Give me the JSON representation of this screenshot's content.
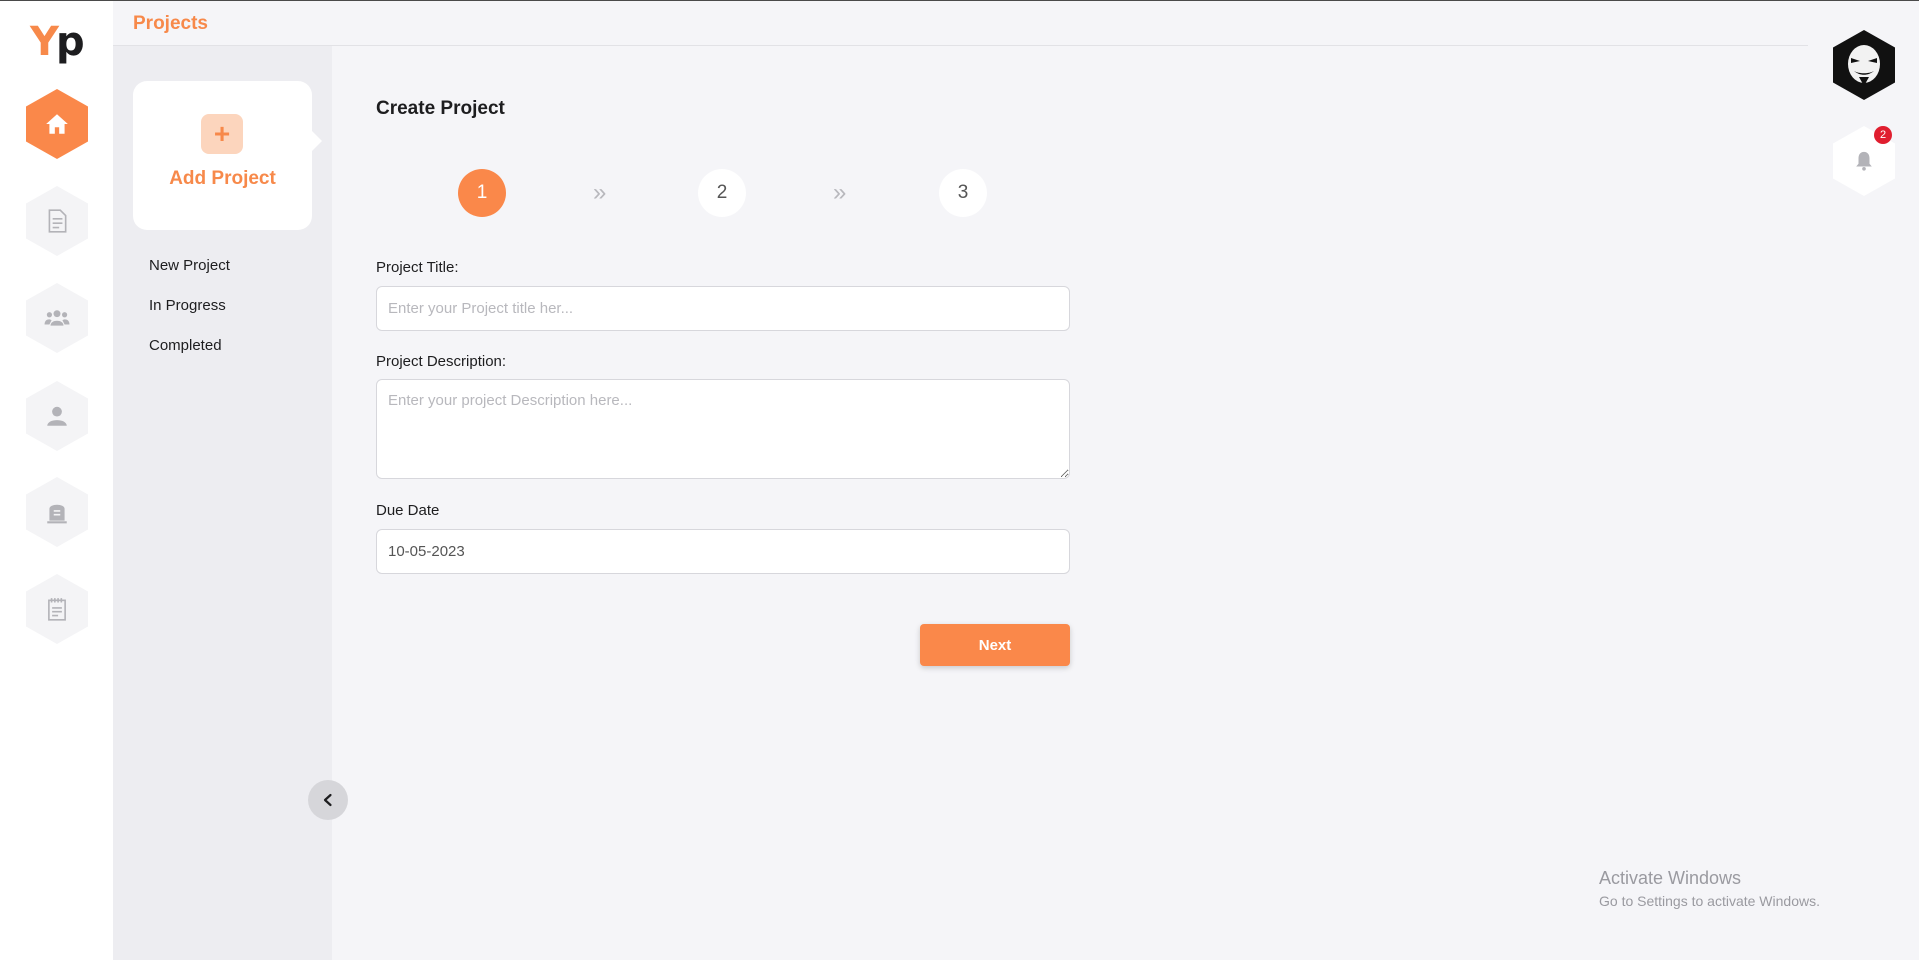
{
  "app": {
    "logo_y": "Y",
    "logo_p": "p",
    "brand_color": "#fa884a"
  },
  "header": {
    "title": "Projects"
  },
  "rail": {
    "items": [
      {
        "icon": "home-icon",
        "active": true
      },
      {
        "icon": "document-icon",
        "active": false
      },
      {
        "icon": "team-icon",
        "active": false
      },
      {
        "icon": "user-icon",
        "active": false
      },
      {
        "icon": "tombstone-icon",
        "active": false
      },
      {
        "icon": "notepad-icon",
        "active": false
      }
    ]
  },
  "sidebar": {
    "add_project": {
      "plus": "+",
      "label": "Add Project"
    },
    "items": [
      {
        "label": "New Project"
      },
      {
        "label": "In Progress"
      },
      {
        "label": "Completed"
      }
    ]
  },
  "form": {
    "title": "Create Project",
    "steps": [
      {
        "label": "1",
        "active": true
      },
      {
        "label": "2",
        "active": false
      },
      {
        "label": "3",
        "active": false
      }
    ],
    "step_separator": "»",
    "project_title": {
      "label": "Project Title:",
      "placeholder": "Enter your Project title her...",
      "value": ""
    },
    "project_description": {
      "label": "Project Description:",
      "placeholder": "Enter your project Description here...",
      "value": ""
    },
    "due_date": {
      "label": "Due Date",
      "value": "10-05-2023"
    },
    "next_label": "Next"
  },
  "notifications": {
    "count": "2"
  },
  "watermark": {
    "title": "Activate Windows",
    "subtitle": "Go to Settings to activate Windows."
  }
}
